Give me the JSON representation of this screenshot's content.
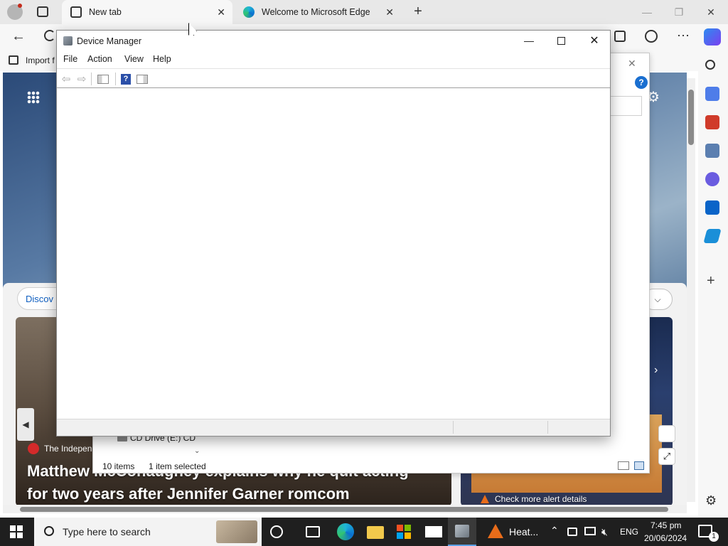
{
  "browser": {
    "tabs": [
      {
        "label": "New tab"
      },
      {
        "label": "Welcome to Microsoft Edge"
      }
    ],
    "favorites_partial": "Import f"
  },
  "page": {
    "discover_partial": "Discov",
    "news_source": "The Indepen",
    "headline_line1": "Matthew McConaughey explains why he quit acting",
    "headline_line2": "for two years after Jennifer Garner romcom",
    "weather_link": "Check more alert details"
  },
  "explorer": {
    "tree_item": "CD Drive (E:) CD",
    "status_items": "10 items",
    "status_selected": "1 item selected"
  },
  "device_manager": {
    "title": "Device Manager",
    "menu": [
      "File",
      "Action",
      "View",
      "Help"
    ]
  },
  "taskbar": {
    "search_placeholder": "Type here to search",
    "weather_label": "Heat...",
    "language": "ENG",
    "time": "7:45 pm",
    "date": "20/06/2024",
    "notification_count": "1"
  },
  "colors": {
    "edge_blue": "#0078d4",
    "taskbar": "#1f1f1f",
    "alert_orange": "#e86c1a"
  }
}
